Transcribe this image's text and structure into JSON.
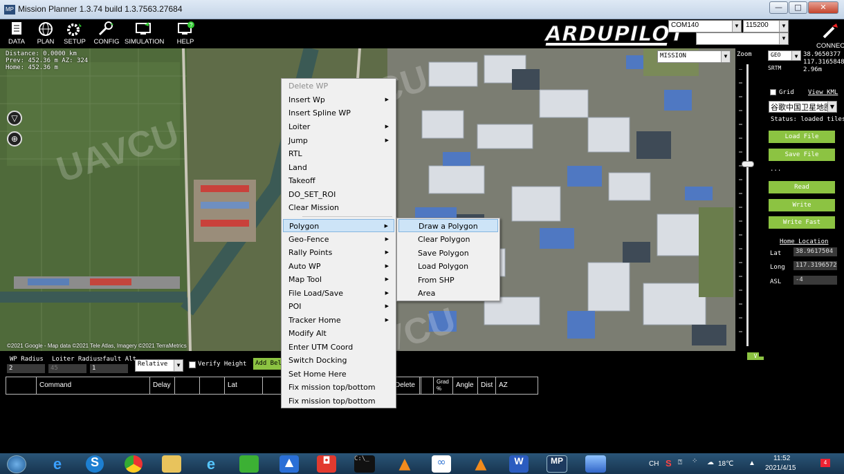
{
  "window": {
    "title": "Mission Planner 1.3.74 build 1.3.7563.27684",
    "app_icon": "MP"
  },
  "toolbar": {
    "buttons": [
      {
        "label": "DATA",
        "icon": "data-icon"
      },
      {
        "label": "PLAN",
        "icon": "plan-globe-icon"
      },
      {
        "label": "SETUP",
        "icon": "setup-icon"
      },
      {
        "label": "CONFIG",
        "icon": "config-icon"
      },
      {
        "label": "SIMULATION",
        "icon": "simulation-icon"
      },
      {
        "label": "HELP",
        "icon": "help-icon"
      }
    ],
    "logo": "ARDUPILOT",
    "port": "COM140",
    "baud": "115200",
    "connect_label": "CONNECT"
  },
  "map": {
    "info_lines": [
      "Distance: 0.0000 km",
      "Prev: 452.36 m AZ: 324",
      "Home: 452.36 m"
    ],
    "mission_mode": "MISSION",
    "credit": "©2021 Google - Map data ©2021 Tele Atlas, Imagery ©2021 TerraMetrics",
    "watermark": "UAVCU"
  },
  "zoom": {
    "label": "Zoom",
    "v_button": "V",
    "level_fraction": 0.65
  },
  "right_panel": {
    "geo": "GEO",
    "srtm": "SRTM",
    "lat_readout": "38.9650377",
    "lng_readout": "117.3165848",
    "alt_readout": "2.96m",
    "grid_label": "Grid",
    "view_kml": "View KML",
    "map_source": "谷歌中国卫星地图",
    "status": "Status: loaded tiles",
    "ellipsis": "...",
    "buttons": [
      "Load File",
      "Save File",
      "Read",
      "Write",
      "Write Fast"
    ],
    "home_location": {
      "title": "Home Location",
      "lat_label": "Lat",
      "lat": "38.9617504",
      "long_label": "Long",
      "long": "117.3196572",
      "asl_label": "ASL",
      "asl": "-4"
    }
  },
  "bottom": {
    "wp_radius_label": "WP Radius",
    "loiter_radius_label": "Loiter Radius",
    "default_alt_label": "Default Alt",
    "wp_radius": "2",
    "loiter_radius": "45",
    "default_alt": "1",
    "alt_mode": "Relative",
    "verify_height": "Verify Height",
    "add_below": "Add Below",
    "columns": [
      "Command",
      "Delay",
      "",
      "",
      "Lat",
      "",
      "",
      "Delete",
      "",
      "Grad %",
      "Angle",
      "Dist",
      "AZ"
    ]
  },
  "context_menu": {
    "items": [
      {
        "label": "Delete WP",
        "disabled": true,
        "sub": false
      },
      {
        "label": "Insert Wp",
        "sub": true
      },
      {
        "label": "Insert Spline WP",
        "sub": false
      },
      {
        "label": "Loiter",
        "sub": true
      },
      {
        "label": "Jump",
        "sub": true
      },
      {
        "label": "RTL",
        "sub": false
      },
      {
        "label": "Land",
        "sub": false
      },
      {
        "label": "Takeoff",
        "sub": false
      },
      {
        "label": "DO_SET_ROI",
        "sub": false
      },
      {
        "label": "Clear Mission",
        "sub": false
      },
      {
        "label": "Polygon",
        "sub": true,
        "selected": true
      },
      {
        "label": "Geo-Fence",
        "sub": true
      },
      {
        "label": "Rally Points",
        "sub": true
      },
      {
        "label": "Auto WP",
        "sub": true
      },
      {
        "label": "Map Tool",
        "sub": true
      },
      {
        "label": "File Load/Save",
        "sub": true
      },
      {
        "label": "POI",
        "sub": true
      },
      {
        "label": "Tracker Home",
        "sub": true
      },
      {
        "label": "Modify Alt",
        "sub": false
      },
      {
        "label": "Enter UTM Coord",
        "sub": false
      },
      {
        "label": "Switch Docking",
        "sub": false
      },
      {
        "label": "Set Home Here",
        "sub": false
      },
      {
        "label": "Fix mission top/bottom",
        "sub": false
      },
      {
        "label": "Fix mission top/bottom",
        "sub": false
      }
    ],
    "submenu_arrow": "▶",
    "polygon_submenu": [
      "Draw a Polygon",
      "Clear Polygon",
      "Save Polygon",
      "Load Polygon",
      "From SHP",
      "Area"
    ]
  },
  "taskbar": {
    "ime": "CH",
    "temperature": "18℃",
    "time": "11:52",
    "date": "2021/4/15",
    "badge": "4"
  }
}
